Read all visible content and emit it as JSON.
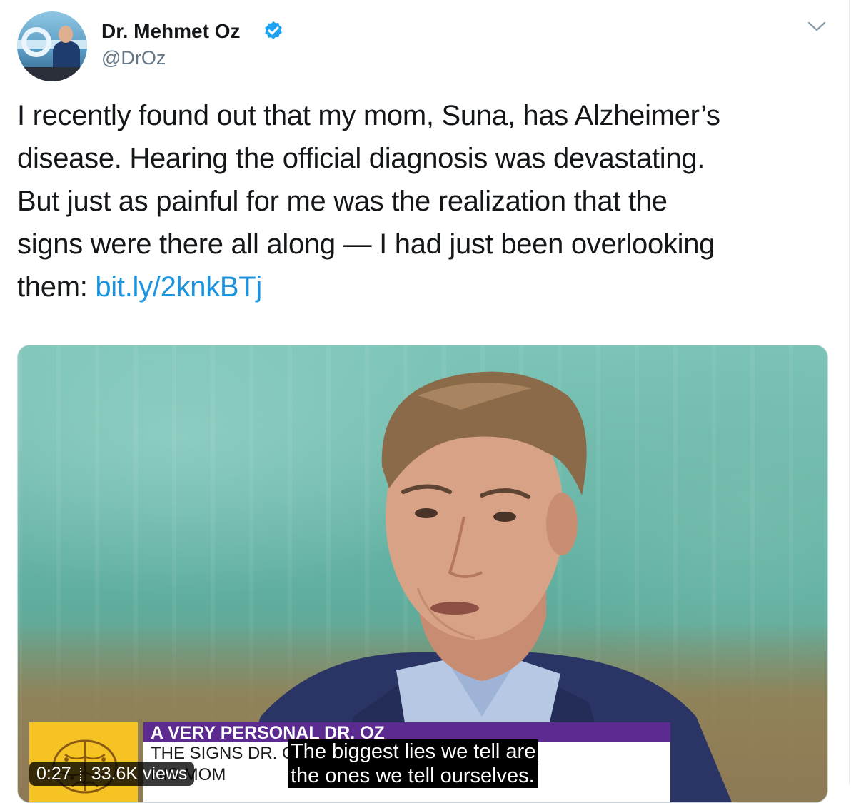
{
  "author": {
    "name": "Dr. Mehmet Oz",
    "handle": "@DrOz",
    "verified": true
  },
  "icons": {
    "verified": "verified-badge-icon",
    "menu": "chevron-down-icon",
    "video_logo": "brain-icon"
  },
  "tweet": {
    "lines": [
      "I recently found out that my mom, Suna, has Alzheimer’s",
      "disease. Hearing the official diagnosis was devastating.",
      "But just as painful for me was the realization that the",
      "signs were there all along — I had just been overlooking"
    ],
    "last_line_prefix": "them: ",
    "link": "bit.ly/2knkBTj"
  },
  "video": {
    "lower_third_title": "A VERY PERSONAL DR. OZ",
    "lower_third_line1": "THE SIGNS DR. O",
    "lower_third_line2": "HIS MOM",
    "caption_lines": [
      "The biggest lies we tell are",
      "the ones we tell ourselves."
    ],
    "duration": "0:27",
    "views": "33.6K views"
  },
  "colors": {
    "link": "#1b95e0",
    "verified": "#1da1f2",
    "secondary_text": "#657786",
    "lower_third_purple": "#5b2b8f",
    "lower_third_yellow": "#f6c325"
  }
}
